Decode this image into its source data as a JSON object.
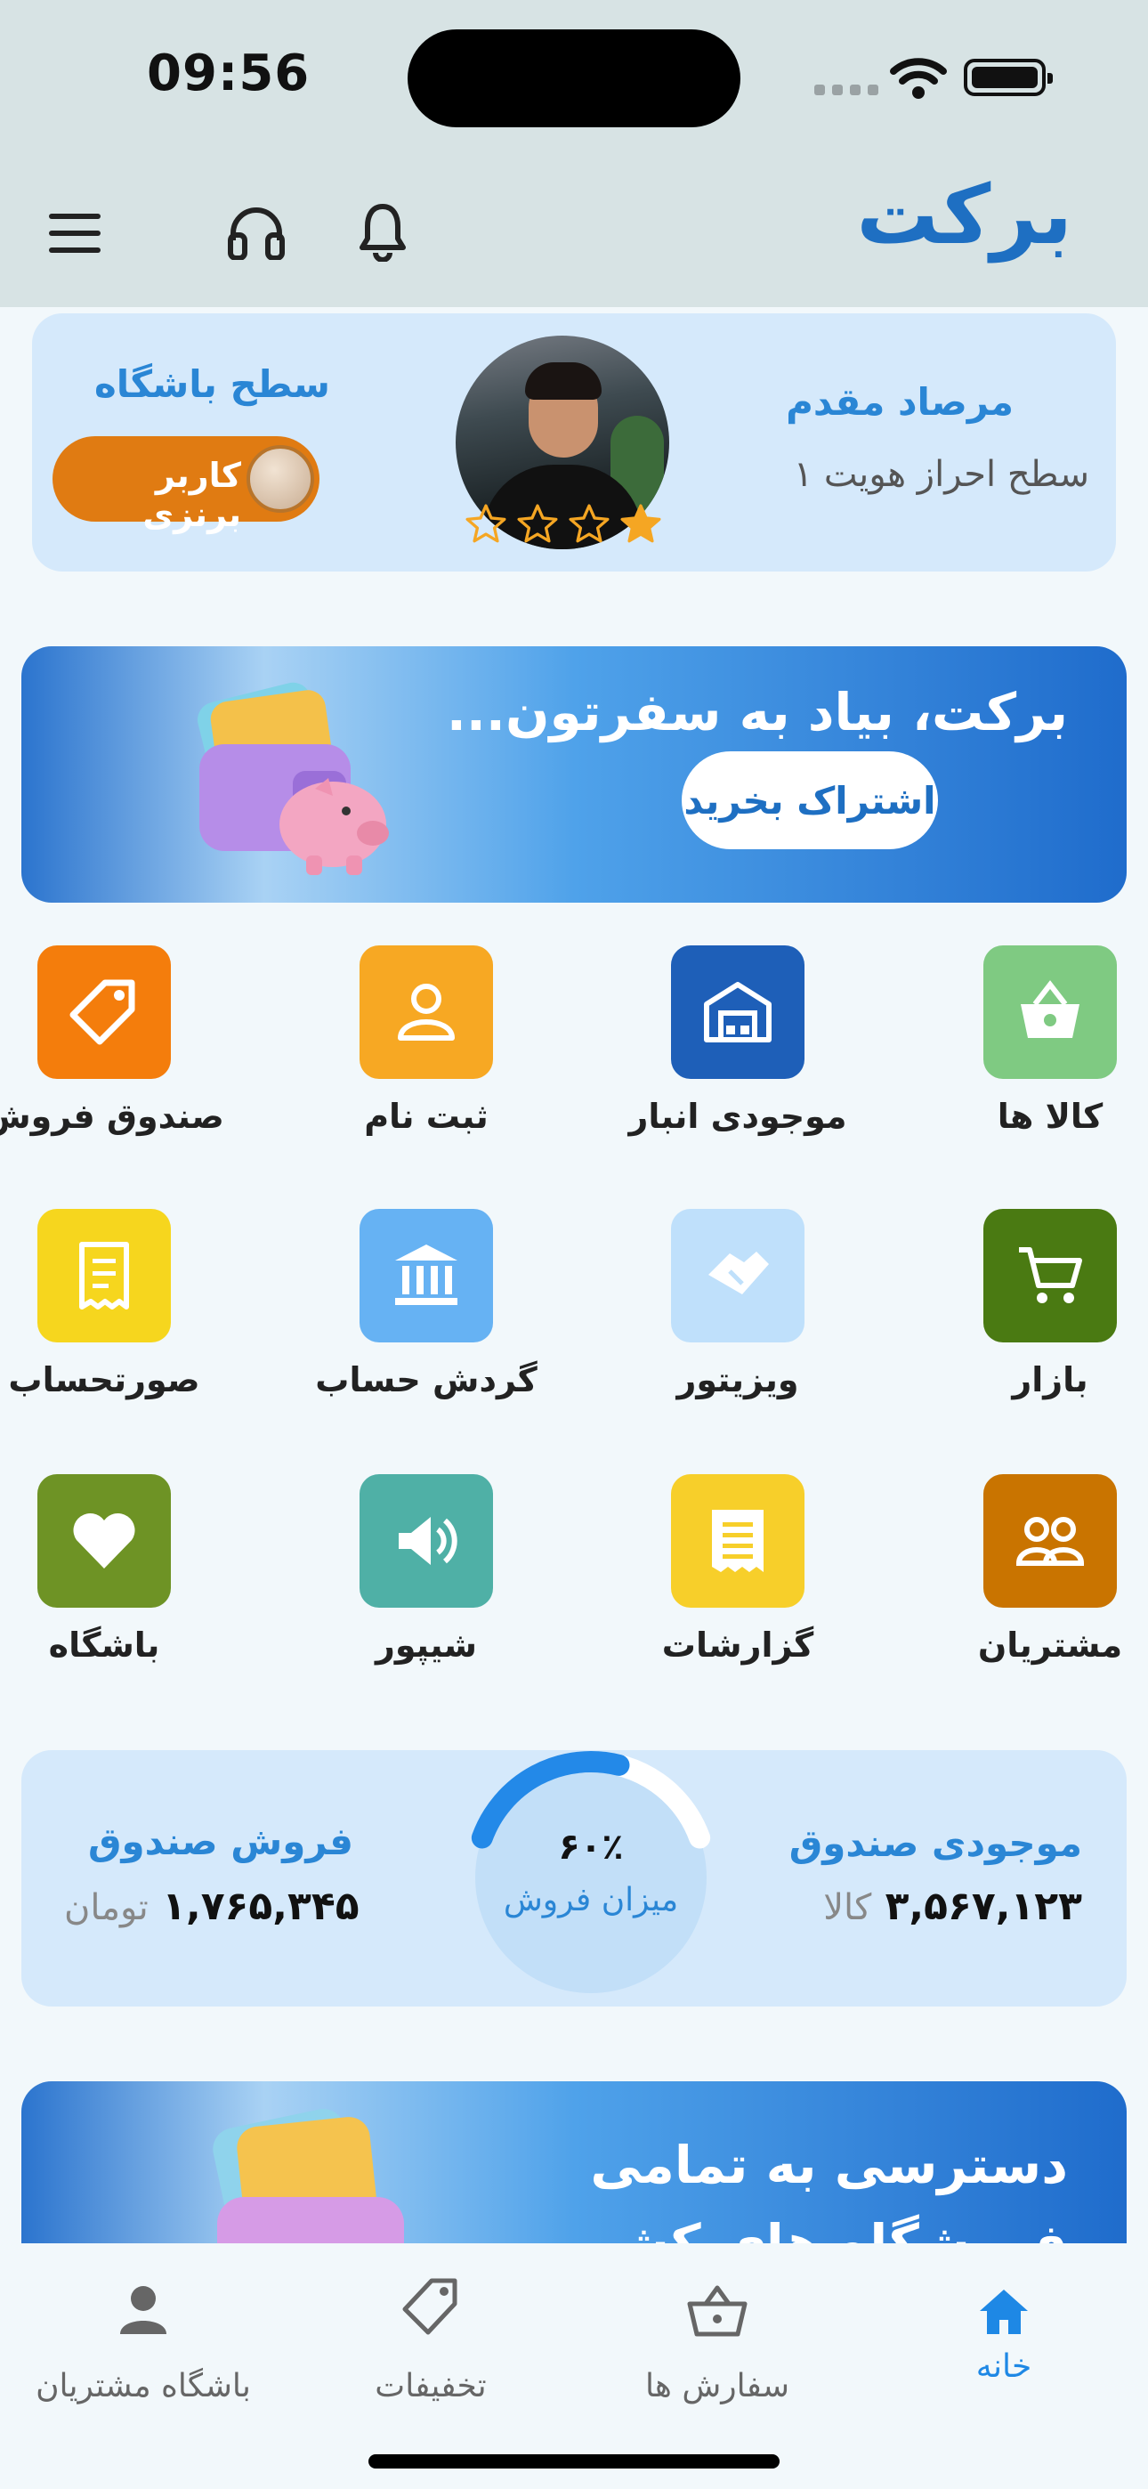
{
  "status_bar": {
    "time": "09:56"
  },
  "header": {
    "app_title": "برکت"
  },
  "profile": {
    "name": "مرصاد مقدم",
    "verification_level": "سطح احراز هویت ۱",
    "club_title": "سطح باشگاه",
    "club_badge": "کاربر برنزی",
    "rating_stars": 1,
    "rating_max": 4
  },
  "promo_banner": {
    "title": "برکت، بیاد به سفرتون...",
    "button": "اشتراک بخرید"
  },
  "services": [
    {
      "label": "کالا ها",
      "icon": "basket-icon",
      "color": "#7fca82"
    },
    {
      "label": "موجودی انبار",
      "icon": "warehouse-icon",
      "color": "#1e5fb8"
    },
    {
      "label": "ثبت نام",
      "icon": "user-icon",
      "color": "#f7a823"
    },
    {
      "label": "صندوق فروش",
      "icon": "tag-icon",
      "color": "#f47d0c"
    },
    {
      "label": "بازار",
      "icon": "cart-icon",
      "color": "#4a7a12"
    },
    {
      "label": "ویزیتور",
      "icon": "handshake-icon",
      "color": "#bfe0fb"
    },
    {
      "label": "گردش حساب",
      "icon": "bank-icon",
      "color": "#66b2f3"
    },
    {
      "label": "صورتحساب",
      "icon": "receipt-icon",
      "color": "#f6d61e"
    },
    {
      "label": "مشتریان",
      "icon": "users-icon",
      "color": "#c97400"
    },
    {
      "label": "گزارشات",
      "icon": "report-icon",
      "color": "#f7cf2a"
    },
    {
      "label": "شیپور",
      "icon": "speaker-icon",
      "color": "#4fb0a6"
    },
    {
      "label": "باشگاه",
      "icon": "heart-icon",
      "color": "#6e9325"
    }
  ],
  "stats": {
    "stock_title": "موجودی صندوق",
    "stock_value": "۳,۵۶۷,۱۲۳",
    "stock_unit": "کالا",
    "sales_title": "فروش صندوق",
    "sales_value": "۱,۷۶۵,۳۴۵",
    "sales_unit": "تومان",
    "gauge_value": "۶۰٪",
    "gauge_percent": 60,
    "gauge_label": "میزان فروش"
  },
  "second_banner": {
    "title": "دسترسی به تمامی",
    "title_line2": "فروشگاه های کشور"
  },
  "bottom_nav": [
    {
      "label": "خانه",
      "icon": "home-icon",
      "active": true
    },
    {
      "label": "سفارش ها",
      "icon": "basket-icon",
      "active": false
    },
    {
      "label": "تخفیفات",
      "icon": "tag-icon",
      "active": false
    },
    {
      "label": "باشگاه مشتریان",
      "icon": "person-icon",
      "active": false
    }
  ],
  "colors": {
    "primary": "#1e6fc2",
    "accent_blue": "#2a86d5",
    "bronze": "#e07b12",
    "header_bg": "#d7e3e4",
    "card_bg": "#d5e9fb"
  }
}
